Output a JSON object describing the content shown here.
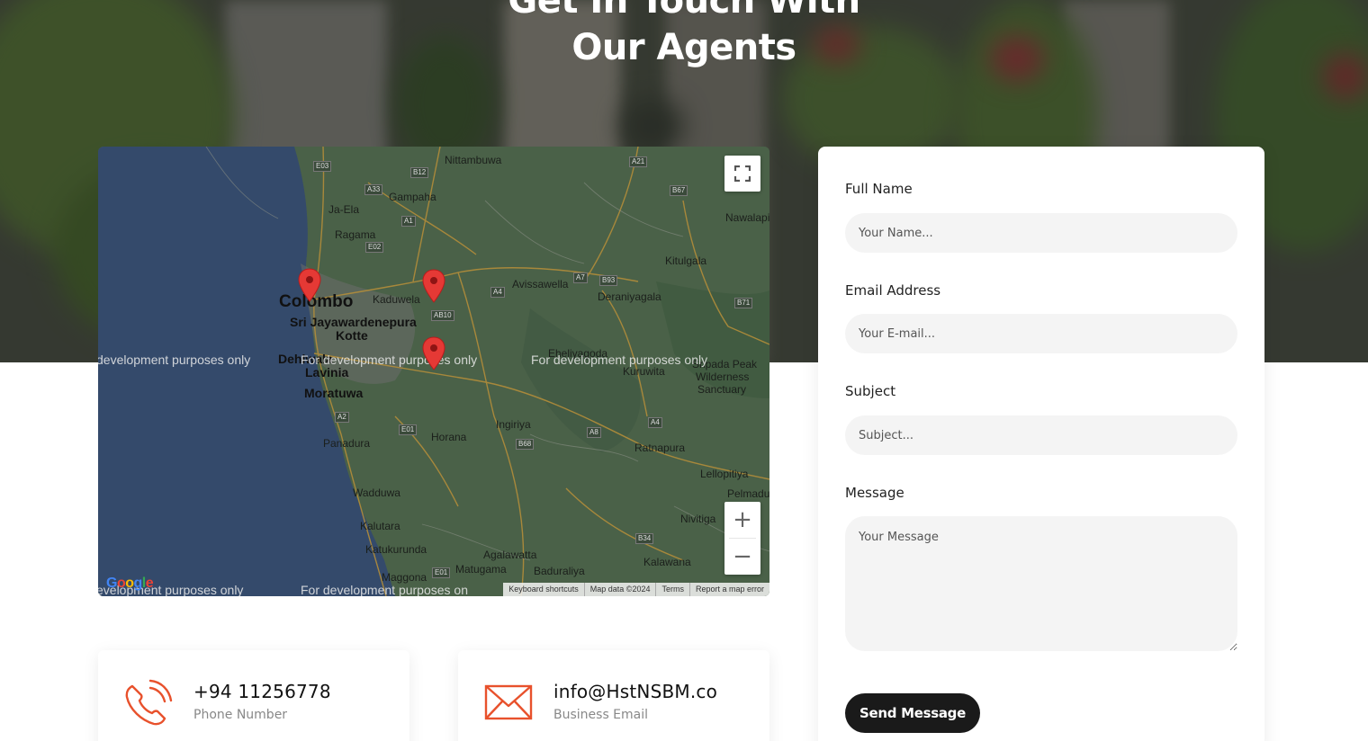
{
  "hero": {
    "title_line1": "Get In Touch With",
    "title_line2": "Our Agents"
  },
  "map": {
    "places": {
      "nittambuwa": "Nittambuwa",
      "gampaha": "Gampaha",
      "ja_ela": "Ja-Ela",
      "ragama": "Ragama",
      "nawalapi": "Nawalapi",
      "kitulgala": "Kitulgala",
      "avissawella": "Avissawella",
      "deraniyagala": "Deraniyagala",
      "colombo": "Colombo",
      "kaduwela": "Kaduwela",
      "sri_jaya": "Sri Jayawardenepura",
      "kotte": "Kotte",
      "dehiwala": "Dehiwala",
      "lavinia": "Lavinia",
      "moratuwa": "Moratuwa",
      "eheliyagoda": "Eheliyagoda",
      "kuruwita": "Kuruwita",
      "sinharaja": "Sripada Peak",
      "wilderness": "Wilderness",
      "sanctuary": "Sanctuary",
      "ingiriya": "Ingiriya",
      "horana": "Horana",
      "panadura": "Panadura",
      "ratnapura": "Ratnapura",
      "lellopitiya": "Lellopitiya",
      "pelmadulla": "Pelmadu",
      "waddduwa": "Wadduwa",
      "nivithigala": "Nivitiga",
      "kalutara": "Kalutara",
      "katukurunda": "Katukurunda",
      "agalawatta": "Agalawatta",
      "kalawana": "Kalawana",
      "maggona": "Maggona",
      "matugama": "Matugama",
      "baduraliya": "Baduraliya"
    },
    "roads": {
      "e03": "E03",
      "b12": "B12",
      "a21": "A21",
      "a33": "A33",
      "b67": "B67",
      "a1": "A1",
      "e02": "E02",
      "a7": "A7",
      "b93": "B93",
      "a4": "A4",
      "ab10": "AB10",
      "b71": "B71",
      "a2": "A2",
      "e01": "E01",
      "a8": "A8",
      "a4b": "A4",
      "b68": "B68",
      "b34": "B34",
      "e01b": "E01"
    },
    "dev_text": "For development purposes only",
    "dev_text_left": "development purposes only",
    "dev_text_bottom_left": "evelopment purposes only",
    "dev_text_bottom_mid": "For development purposes on",
    "dev_text_overlap": "For development purposes only",
    "attribution": [
      "Keyboard shortcuts",
      "Map data ©2024",
      "Terms",
      "Report a map error"
    ],
    "google_logo": "Google",
    "fullscreen_icon": "fullscreen-icon",
    "zoom_in": "+",
    "zoom_out": "−",
    "pin_color": "#e53935"
  },
  "form": {
    "full_name_label": "Full Name",
    "full_name_placeholder": "Your Name...",
    "email_label": "Email Address",
    "email_placeholder": "Your E-mail...",
    "subject_label": "Subject",
    "subject_placeholder": "Subject...",
    "message_label": "Message",
    "message_placeholder": "Your Message",
    "send_label": "Send Message"
  },
  "contacts": {
    "phone_value": "+94 11256778",
    "phone_label": "Phone Number",
    "email_value": "info@HstNSBM.co",
    "email_label": "Business Email",
    "accent_color": "#e8512c"
  }
}
